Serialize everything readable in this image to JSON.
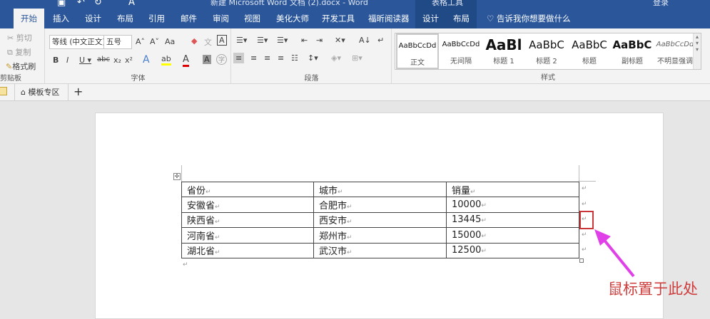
{
  "window": {
    "title": "新建 Microsoft Word 文档 (2).docx - Word",
    "contextual": "表格工具",
    "signin": "登录"
  },
  "tabs": [
    "开始",
    "插入",
    "设计",
    "布局",
    "引用",
    "邮件",
    "审阅",
    "视图",
    "美化大师",
    "开发工具",
    "福昕阅读器",
    "设计",
    "布局"
  ],
  "tell_me": "告诉我你想要做什么",
  "clipboard": {
    "cut": "剪切",
    "copy": "复制",
    "painter": "格式刷",
    "label": "剪贴板"
  },
  "font": {
    "name": "等线 (中文正文)",
    "size": "五号",
    "label": "字体",
    "change_case": "Aa"
  },
  "paragraph": {
    "label": "段落"
  },
  "styles": {
    "label": "样式",
    "items": [
      {
        "preview": "AaBbCcDd",
        "name": "正文"
      },
      {
        "preview": "AaBbCcDd",
        "name": "无间隔"
      },
      {
        "preview": "AaBl",
        "name": "标题 1"
      },
      {
        "preview": "AaBbC",
        "name": "标题 2"
      },
      {
        "preview": "AaBbC",
        "name": "标题"
      },
      {
        "preview": "AaBbC",
        "name": "副标题"
      },
      {
        "preview": "AaBbCcDd",
        "name": "不明显强调"
      }
    ]
  },
  "doc_tabs": {
    "template": "模板专区",
    "add": "+"
  },
  "table": {
    "headers": [
      "省份",
      "城市",
      "销量"
    ],
    "rows": [
      [
        "安徽省",
        "合肥市",
        "10000"
      ],
      [
        "陕西省",
        "西安市",
        "13445"
      ],
      [
        "河南省",
        "郑州市",
        "15000"
      ],
      [
        "湖北省",
        "武汉市",
        "12500"
      ]
    ]
  },
  "annotation": {
    "text": "鼠标置于此处",
    "color": "#cf3c3c",
    "arrow_color": "#e040e8"
  },
  "colors": {
    "brand": "#2b579a"
  }
}
